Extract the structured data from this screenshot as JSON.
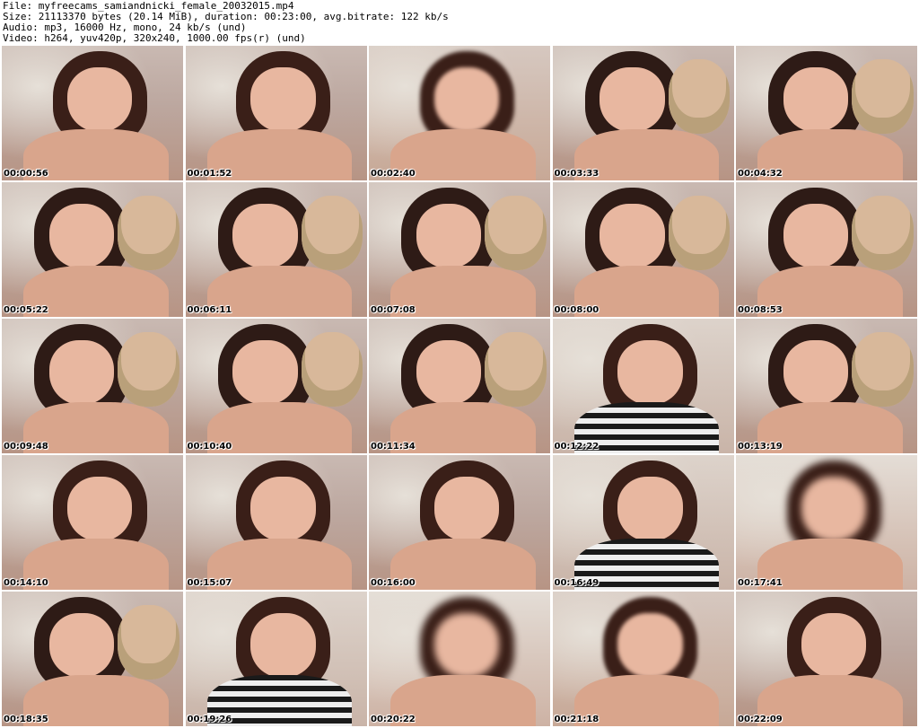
{
  "header": {
    "file": "File: myfreecams_samiandnicki_female_20032015.mp4",
    "size": "Size: 21113370 bytes (20.14 MiB), duration: 00:23:00, avg.bitrate: 122 kb/s",
    "audio": "Audio: mp3, 16000 Hz, mono, 24 kb/s (und)",
    "video": "Video: h264, yuv420p, 320x240, 1000.00 fps(r) (und)"
  },
  "thumbnails": [
    {
      "timestamp": "00:00:56",
      "variant": "v1"
    },
    {
      "timestamp": "00:01:52",
      "variant": "v1"
    },
    {
      "timestamp": "00:02:40",
      "variant": "v3"
    },
    {
      "timestamp": "00:03:33",
      "variant": "v2"
    },
    {
      "timestamp": "00:04:32",
      "variant": "v2"
    },
    {
      "timestamp": "00:05:22",
      "variant": "v2"
    },
    {
      "timestamp": "00:06:11",
      "variant": "v2"
    },
    {
      "timestamp": "00:07:08",
      "variant": "v2"
    },
    {
      "timestamp": "00:08:00",
      "variant": "v2"
    },
    {
      "timestamp": "00:08:53",
      "variant": "v2"
    },
    {
      "timestamp": "00:09:48",
      "variant": "v2"
    },
    {
      "timestamp": "00:10:40",
      "variant": "v2"
    },
    {
      "timestamp": "00:11:34",
      "variant": "v2"
    },
    {
      "timestamp": "00:12:22",
      "variant": "v4"
    },
    {
      "timestamp": "00:13:19",
      "variant": "v2"
    },
    {
      "timestamp": "00:14:10",
      "variant": "v1"
    },
    {
      "timestamp": "00:15:07",
      "variant": "v1"
    },
    {
      "timestamp": "00:16:00",
      "variant": "v1"
    },
    {
      "timestamp": "00:16:49",
      "variant": "v4"
    },
    {
      "timestamp": "00:17:41",
      "variant": "v5"
    },
    {
      "timestamp": "00:18:35",
      "variant": "v2"
    },
    {
      "timestamp": "00:19:26",
      "variant": "v4"
    },
    {
      "timestamp": "00:20:22",
      "variant": "v5"
    },
    {
      "timestamp": "00:21:18",
      "variant": "v3"
    },
    {
      "timestamp": "00:22:09",
      "variant": "v1"
    }
  ]
}
